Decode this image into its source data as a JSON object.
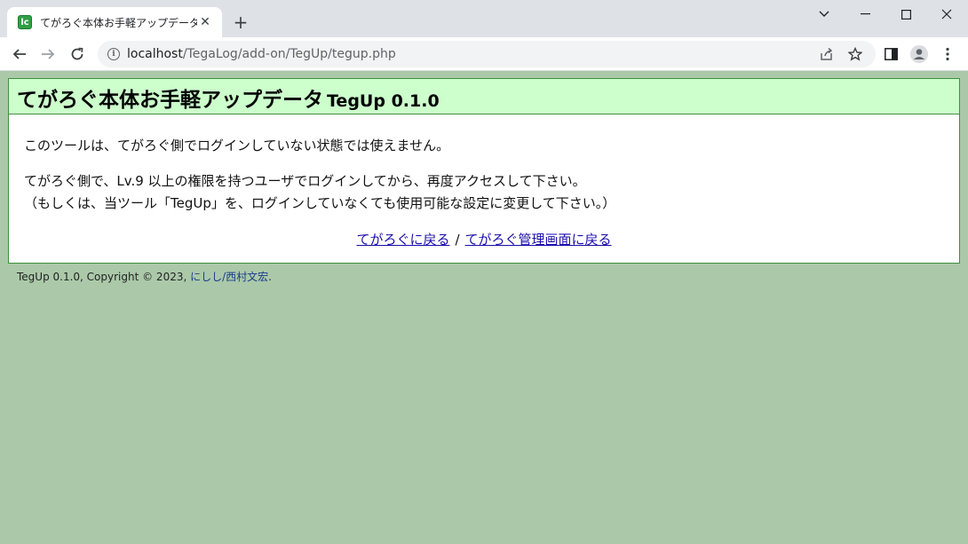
{
  "browser": {
    "tab_title": "てがろぐ本体お手軽アップデータ TegUp",
    "favicon_text": "lc",
    "tab_close": "✕",
    "new_tab": "+",
    "url_host": "localhost",
    "url_path": "/TegaLog/add-on/TegUp/tegup.php"
  },
  "header": {
    "title": "てがろぐ本体お手軽アップデータ",
    "version": "TegUp 0.1.0"
  },
  "message": {
    "line1": "このツールは、てがろぐ側でログインしていない状態では使えません。",
    "line2": "てがろぐ側で、Lv.9 以上の権限を持つユーザでログインしてから、再度アクセスして下さい。",
    "line3": "（もしくは、当ツール「TegUp」を、ログインしていなくても使用可能な設定に変更して下さい。）"
  },
  "links": {
    "back_to_tegalog": "てがろぐに戻る",
    "separator": "/",
    "back_to_admin": "てがろぐ管理画面に戻る"
  },
  "footer": {
    "text": "TegUp 0.1.0, Copyright © 2023,",
    "author": "にしし/西村文宏",
    "period": "."
  },
  "colors": {
    "page_bg": "#abc9a9",
    "header_bg": "#ccffcc",
    "border": "#3f8f3f",
    "link": "#1a0dab"
  }
}
